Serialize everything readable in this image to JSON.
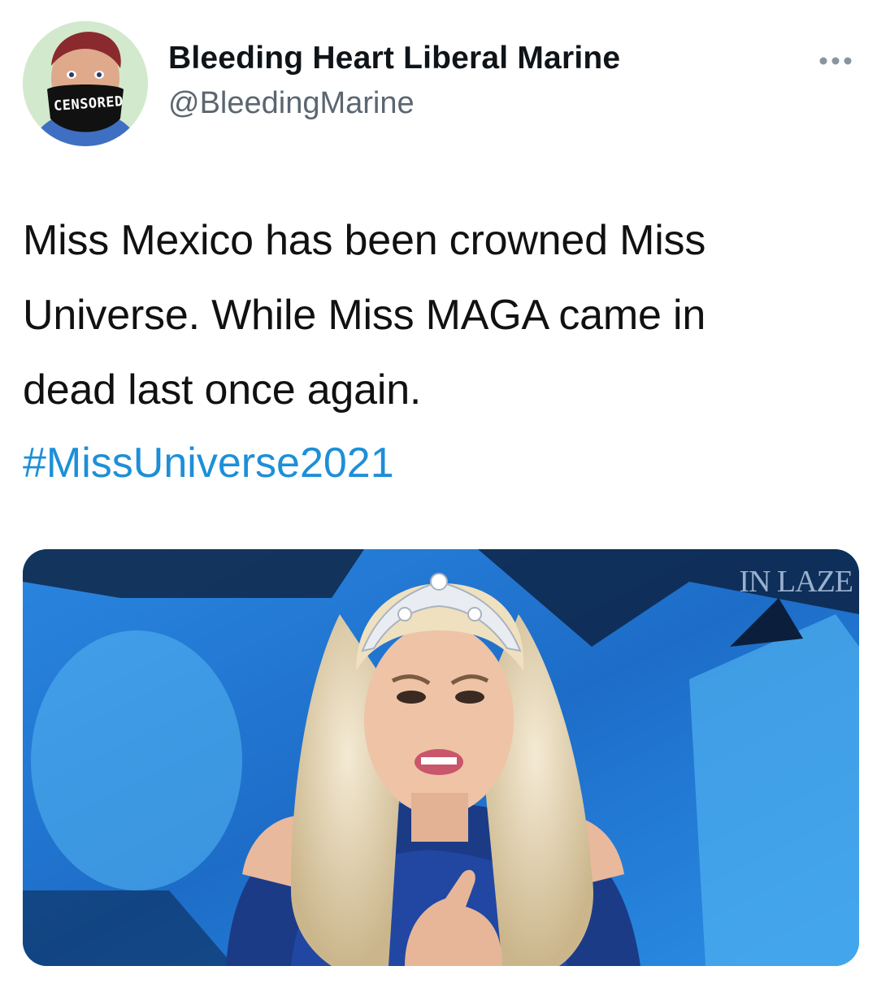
{
  "author": {
    "display_name": "Bleeding Heart Liberal Marine",
    "handle": "@BleedingMarine",
    "avatar_mask_text": "CENSORED"
  },
  "more_icon": "ellipsis-icon",
  "tweet": {
    "text_lines": [
      "Miss Mexico has been crowned Miss",
      "Universe. While Miss MAGA came in",
      "dead last once again."
    ],
    "hashtag": "#MissUniverse2021"
  },
  "media": {
    "watermark": "IN LAZE"
  },
  "colors": {
    "hashtag": "#1d8fd8",
    "handle": "#5b6671",
    "text": "#111111"
  }
}
